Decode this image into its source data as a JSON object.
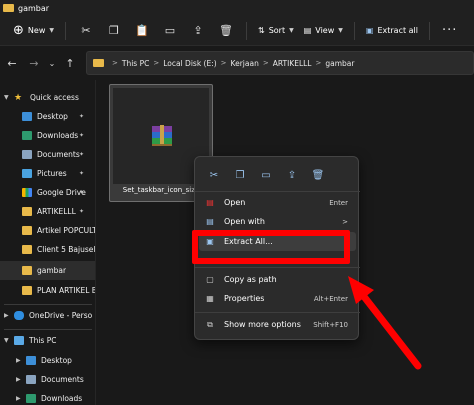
{
  "window": {
    "title": "gambar"
  },
  "toolbar": {
    "new_label": "New",
    "sort_label": "Sort",
    "view_label": "View",
    "extract_label": "Extract all",
    "more": "···"
  },
  "address": {
    "crumbs": [
      "This PC",
      "Local Disk (E:)",
      "Kerjaan",
      "ARTIKELLL",
      "gambar"
    ],
    "separator": ">"
  },
  "sidebar": {
    "items": [
      {
        "label": "Quick access",
        "icon": "star-icon",
        "pinned": false
      },
      {
        "label": "Desktop",
        "icon": "desktop-folder-icon",
        "pinned": true
      },
      {
        "label": "Downloads",
        "icon": "downloads-folder-icon",
        "pinned": true
      },
      {
        "label": "Documents",
        "icon": "documents-folder-icon",
        "pinned": true
      },
      {
        "label": "Pictures",
        "icon": "pictures-folder-icon",
        "pinned": true
      },
      {
        "label": "Google Drive",
        "icon": "google-drive-icon",
        "pinned": true
      },
      {
        "label": "ARTIKELLL",
        "icon": "folder-icon",
        "pinned": true
      },
      {
        "label": "Artikel POPCULT",
        "icon": "folder-icon",
        "pinned": false
      },
      {
        "label": "Client 5 Bajusel",
        "icon": "folder-icon",
        "pinned": false
      },
      {
        "label": "gambar",
        "icon": "folder-icon",
        "pinned": false
      },
      {
        "label": "PLAN ARTIKEL B",
        "icon": "folder-icon",
        "pinned": false
      },
      {
        "label": "OneDrive - Perso",
        "icon": "onedrive-icon",
        "pinned": false
      },
      {
        "label": "This PC",
        "icon": "this-pc-icon",
        "pinned": false
      },
      {
        "label": "Desktop",
        "icon": "desktop-folder-icon",
        "pinned": false
      },
      {
        "label": "Documents",
        "icon": "documents-folder-icon",
        "pinned": false
      },
      {
        "label": "Downloads",
        "icon": "downloads-folder-icon",
        "pinned": false
      }
    ]
  },
  "file": {
    "name": "Set_taskbar_icon_size"
  },
  "context_menu": {
    "items": [
      {
        "label": "Open",
        "shortcut": "Enter"
      },
      {
        "label": "Open with",
        "shortcut": ">"
      },
      {
        "label": "Extract All...",
        "shortcut": ""
      },
      {
        "label": "Copy as path",
        "shortcut": ""
      },
      {
        "label": "Properties",
        "shortcut": "Alt+Enter"
      },
      {
        "label": "Show more options",
        "shortcut": "Shift+F10"
      }
    ]
  },
  "colors": {
    "annotation": "#ff0000",
    "folder": "#e8b94a",
    "background": "#191919",
    "menu": "#2b2b2b"
  }
}
